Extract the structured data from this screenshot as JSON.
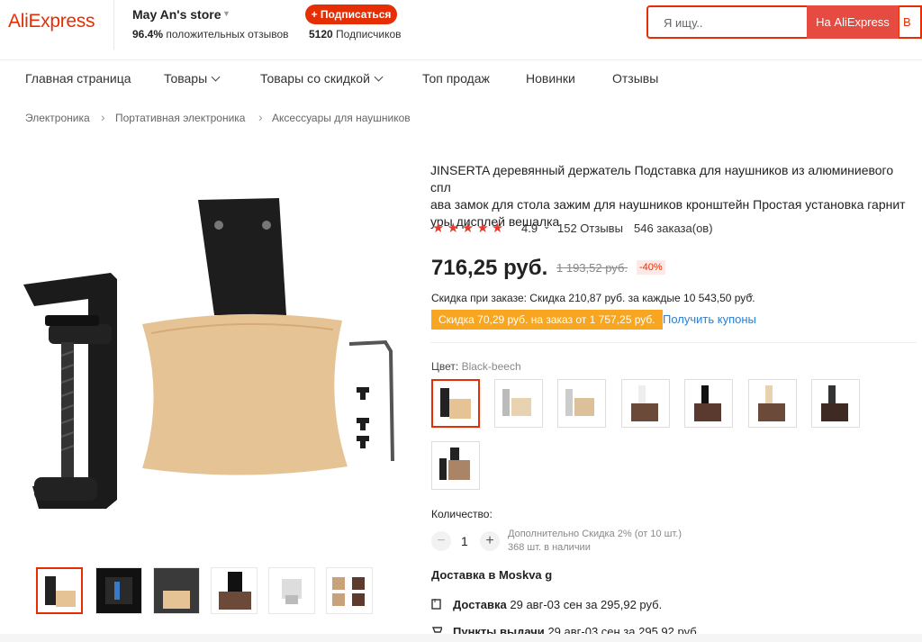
{
  "header": {
    "logo": "AliExpress",
    "store_name": "May An's store",
    "subscribe_label": "+ Подписаться",
    "positive_pct": "96.4%",
    "positive_text": "положительных отзывов",
    "subscribers_count": "5120",
    "subscribers_text": "Подписчиков",
    "search_placeholder": "Я ищу..",
    "search_button": "На AliExpress",
    "search_button2": "В"
  },
  "nav": [
    "Главная страница",
    "Товары",
    "Товары со скидкой",
    "Топ продаж",
    "Новинки",
    "Отзывы"
  ],
  "breadcrumb": [
    "Электроника",
    "Портативная электроника",
    "Аксессуары для наушников"
  ],
  "product": {
    "title_lines": [
      "JINSERTA деревянный держатель Подставка для наушников из алюминиевого спл",
      "ава замок для стола зажим для наушников кронштейн Простая установка гарнит",
      "уры дисплей вешалка"
    ],
    "stars": "★★★★★",
    "rating": "4.9",
    "reviews": "152 Отзывы",
    "orders": "546 заказа(ов)",
    "price": "716,25 руб.",
    "old_price": "1 193,52 руб.",
    "discount": "-40%",
    "bulk_discount": "Скидка при заказе: Скидка 210,87 руб. за каждые 10 543,50 руб.",
    "coupon_text": "Скидка 70,29 руб. на заказ от 1 757,25 руб.",
    "get_coupons": "Получить купоны",
    "color_label": "Цвет:",
    "color_value": "Black-beech",
    "quantity_label": "Количество:",
    "quantity": "1",
    "qty_minus": "−",
    "qty_plus": "+",
    "qty_extra_discount": "Дополнительно Скидка 2% (от 10 шт.)",
    "stock": "368 шт. в наличии",
    "shipping_title": "Доставка в Moskva g",
    "delivery_label": "Доставка",
    "delivery_text": "29 авг-03 сен за 295,92 руб.",
    "pickup_label": "Пункты выдачи",
    "pickup_text": "29 авг-03 сен за 295,92 руб."
  },
  "colors": {
    "accent": "#e62e04",
    "coupon_bg": "#f8a620",
    "link": "#2d7fcf",
    "star": "#e63a2e"
  }
}
